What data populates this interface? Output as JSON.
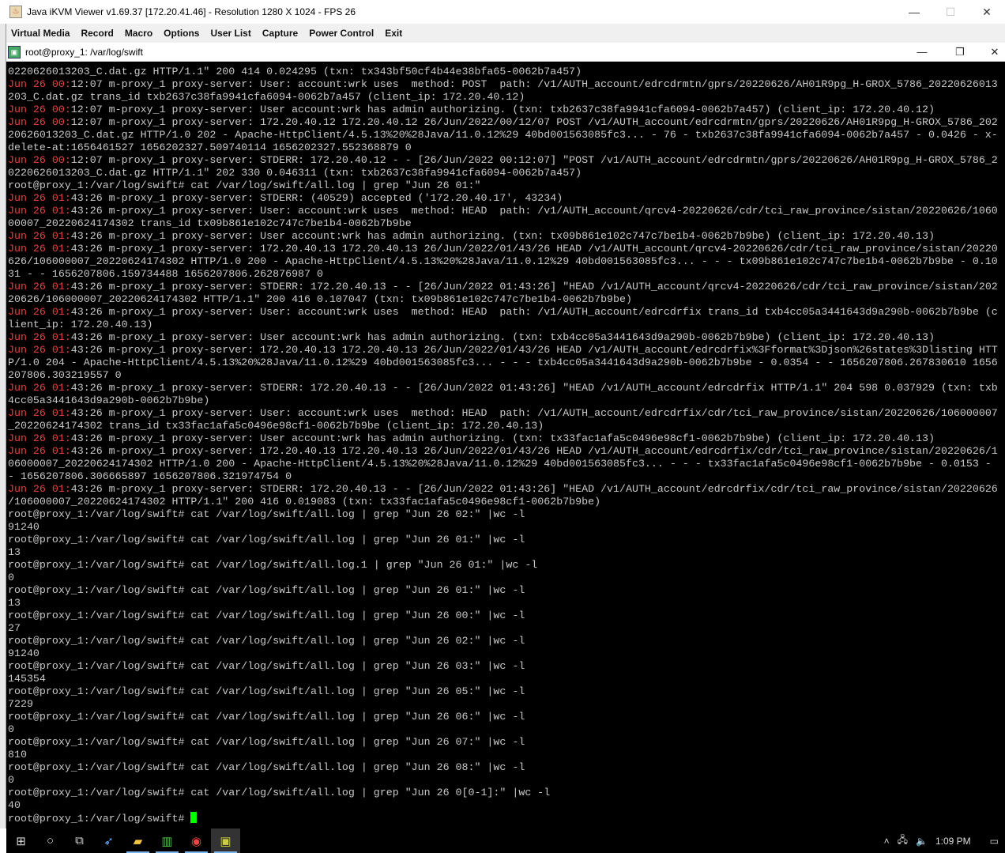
{
  "window": {
    "title": "Java iKVM Viewer v1.69.37 [172.20.41.46]  - Resolution 1280 X 1024 - FPS 26",
    "minimize": "—",
    "maximize": "☐",
    "close": "✕"
  },
  "menu": [
    "Virtual Media",
    "Record",
    "Macro",
    "Options",
    "User List",
    "Capture",
    "Power Control",
    "Exit"
  ],
  "terminal_window": {
    "title": "root@proxy_1: /var/log/swift",
    "minimize": "—",
    "restore": "❐",
    "close": "✕"
  },
  "terminal": {
    "lines": [
      {
        "p": "",
        "t": "0220626013203_C.dat.gz HTTP/1.1\" 200 414 0.024295 (txn: tx343bf50cf4b44e38bfa65-0062b7a457)"
      },
      {
        "p": "Jun 26 00:",
        "t": "12:07 m-proxy_1 proxy-server: User: account:wrk uses  method: POST  path: /v1/AUTH_account/edrcdrmtn/gprs/20220626/AH01R9pg_H-GROX_5786_20220626013"
      },
      {
        "p": "",
        "t": "203_C.dat.gz trans_id txb2637c38fa9941cfa6094-0062b7a457 (client_ip: 172.20.40.12)"
      },
      {
        "p": "Jun 26 00:",
        "t": "12:07 m-proxy_1 proxy-server: User account:wrk has admin authorizing. (txn: txb2637c38fa9941cfa6094-0062b7a457) (client_ip: 172.20.40.12)"
      },
      {
        "p": "Jun 26 00:",
        "t": "12:07 m-proxy_1 proxy-server: 172.20.40.12 172.20.40.12 26/Jun/2022/00/12/07 POST /v1/AUTH_account/edrcdrmtn/gprs/20220626/AH01R9pg_H-GROX_5786_202"
      },
      {
        "p": "",
        "t": "20626013203_C.dat.gz HTTP/1.0 202 - Apache-HttpClient/4.5.13%20%28Java/11.0.12%29 40bd001563085fc3... - 76 - txb2637c38fa9941cfa6094-0062b7a457 - 0.0426 - x-"
      },
      {
        "p": "",
        "t": "delete-at:1656461527 1656202327.509740114 1656202327.552368879 0"
      },
      {
        "p": "Jun 26 00:",
        "t": "12:07 m-proxy_1 proxy-server: STDERR: 172.20.40.12 - - [26/Jun/2022 00:12:07] \"POST /v1/AUTH_account/edrcdrmtn/gprs/20220626/AH01R9pg_H-GROX_5786_2"
      },
      {
        "p": "",
        "t": "0220626013203_C.dat.gz HTTP/1.1\" 202 330 0.046311 (txn: txb2637c38fa9941cfa6094-0062b7a457)"
      },
      {
        "p": "",
        "t": "root@proxy_1:/var/log/swift# cat /var/log/swift/all.log | grep \"Jun 26 01:\""
      },
      {
        "p": "Jun 26 01:",
        "t": "43:26 m-proxy_1 proxy-server: STDERR: (40529) accepted ('172.20.40.17', 43234)"
      },
      {
        "p": "Jun 26 01:",
        "t": "43:26 m-proxy_1 proxy-server: User: account:wrk uses  method: HEAD  path: /v1/AUTH_account/qrcv4-20220626/cdr/tci_raw_province/sistan/20220626/1060"
      },
      {
        "p": "",
        "t": "00007_20220624174302 trans_id tx09b861e102c747c7be1b4-0062b7b9be"
      },
      {
        "p": "Jun 26 01:",
        "t": "43:26 m-proxy_1 proxy-server: User account:wrk has admin authorizing. (txn: tx09b861e102c747c7be1b4-0062b7b9be) (client_ip: 172.20.40.13)"
      },
      {
        "p": "Jun 26 01:",
        "t": "43:26 m-proxy_1 proxy-server: 172.20.40.13 172.20.40.13 26/Jun/2022/01/43/26 HEAD /v1/AUTH_account/qrcv4-20220626/cdr/tci_raw_province/sistan/20220"
      },
      {
        "p": "",
        "t": "626/106000007_20220624174302 HTTP/1.0 200 - Apache-HttpClient/4.5.13%20%28Java/11.0.12%29 40bd001563085fc3... - - - tx09b861e102c747c7be1b4-0062b7b9be - 0.10"
      },
      {
        "p": "",
        "t": "31 - - 1656207806.159734488 1656207806.262876987 0"
      },
      {
        "p": "Jun 26 01:",
        "t": "43:26 m-proxy_1 proxy-server: STDERR: 172.20.40.13 - - [26/Jun/2022 01:43:26] \"HEAD /v1/AUTH_account/qrcv4-20220626/cdr/tci_raw_province/sistan/202"
      },
      {
        "p": "",
        "t": "20626/106000007_20220624174302 HTTP/1.1\" 200 416 0.107047 (txn: tx09b861e102c747c7be1b4-0062b7b9be)"
      },
      {
        "p": "Jun 26 01:",
        "t": "43:26 m-proxy_1 proxy-server: User: account:wrk uses  method: HEAD  path: /v1/AUTH_account/edrcdrfix trans_id txb4cc05a3441643d9a290b-0062b7b9be (c"
      },
      {
        "p": "",
        "t": "lient_ip: 172.20.40.13)"
      },
      {
        "p": "Jun 26 01:",
        "t": "43:26 m-proxy_1 proxy-server: User account:wrk has admin authorizing. (txn: txb4cc05a3441643d9a290b-0062b7b9be) (client_ip: 172.20.40.13)"
      },
      {
        "p": "Jun 26 01:",
        "t": "43:26 m-proxy_1 proxy-server: 172.20.40.13 172.20.40.13 26/Jun/2022/01/43/26 HEAD /v1/AUTH_account/edrcdrfix%3Fformat%3Djson%26states%3Dlisting HTT"
      },
      {
        "p": "",
        "t": "P/1.0 204 - Apache-HttpClient/4.5.13%20%28Java/11.0.12%29 40bd001563085fc3... - - - txb4cc05a3441643d9a290b-0062b7b9be - 0.0354 - - 1656207806.267830610 1656"
      },
      {
        "p": "",
        "t": "207806.303219557 0"
      },
      {
        "p": "Jun 26 01:",
        "t": "43:26 m-proxy_1 proxy-server: STDERR: 172.20.40.13 - - [26/Jun/2022 01:43:26] \"HEAD /v1/AUTH_account/edrcdrfix HTTP/1.1\" 204 598 0.037929 (txn: txb"
      },
      {
        "p": "",
        "t": "4cc05a3441643d9a290b-0062b7b9be)"
      },
      {
        "p": "Jun 26 01:",
        "t": "43:26 m-proxy_1 proxy-server: User: account:wrk uses  method: HEAD  path: /v1/AUTH_account/edrcdrfix/cdr/tci_raw_province/sistan/20220626/106000007"
      },
      {
        "p": "",
        "t": "_20220624174302 trans_id tx33fac1afa5c0496e98cf1-0062b7b9be (client_ip: 172.20.40.13)"
      },
      {
        "p": "Jun 26 01:",
        "t": "43:26 m-proxy_1 proxy-server: User account:wrk has admin authorizing. (txn: tx33fac1afa5c0496e98cf1-0062b7b9be) (client_ip: 172.20.40.13)"
      },
      {
        "p": "Jun 26 01:",
        "t": "43:26 m-proxy_1 proxy-server: 172.20.40.13 172.20.40.13 26/Jun/2022/01/43/26 HEAD /v1/AUTH_account/edrcdrfix/cdr/tci_raw_province/sistan/20220626/1"
      },
      {
        "p": "",
        "t": "06000007_20220624174302 HTTP/1.0 200 - Apache-HttpClient/4.5.13%20%28Java/11.0.12%29 40bd001563085fc3... - - - tx33fac1afa5c0496e98cf1-0062b7b9be - 0.0153 -"
      },
      {
        "p": "",
        "t": "- 1656207806.306665897 1656207806.321974754 0"
      },
      {
        "p": "Jun 26 01:",
        "t": "43:26 m-proxy_1 proxy-server: STDERR: 172.20.40.13 - - [26/Jun/2022 01:43:26] \"HEAD /v1/AUTH_account/edrcdrfix/cdr/tci_raw_province/sistan/20220626"
      },
      {
        "p": "",
        "t": "/106000007_20220624174302 HTTP/1.1\" 200 416 0.019083 (txn: tx33fac1afa5c0496e98cf1-0062b7b9be)"
      },
      {
        "p": "",
        "t": "root@proxy_1:/var/log/swift# cat /var/log/swift/all.log | grep \"Jun 26 02:\" |wc -l"
      },
      {
        "p": "",
        "t": "91240"
      },
      {
        "p": "",
        "t": "root@proxy_1:/var/log/swift# cat /var/log/swift/all.log | grep \"Jun 26 01:\" |wc -l"
      },
      {
        "p": "",
        "t": "13"
      },
      {
        "p": "",
        "t": "root@proxy_1:/var/log/swift# cat /var/log/swift/all.log.1 | grep \"Jun 26 01:\" |wc -l"
      },
      {
        "p": "",
        "t": "0"
      },
      {
        "p": "",
        "t": "root@proxy_1:/var/log/swift# cat /var/log/swift/all.log | grep \"Jun 26 01:\" |wc -l"
      },
      {
        "p": "",
        "t": "13"
      },
      {
        "p": "",
        "t": "root@proxy_1:/var/log/swift# cat /var/log/swift/all.log | grep \"Jun 26 00:\" |wc -l"
      },
      {
        "p": "",
        "t": "27"
      },
      {
        "p": "",
        "t": "root@proxy_1:/var/log/swift# cat /var/log/swift/all.log | grep \"Jun 26 02:\" |wc -l"
      },
      {
        "p": "",
        "t": "91240"
      },
      {
        "p": "",
        "t": "root@proxy_1:/var/log/swift# cat /var/log/swift/all.log | grep \"Jun 26 03:\" |wc -l"
      },
      {
        "p": "",
        "t": "145354"
      },
      {
        "p": "",
        "t": "root@proxy_1:/var/log/swift# cat /var/log/swift/all.log | grep \"Jun 26 05:\" |wc -l"
      },
      {
        "p": "",
        "t": "7229"
      },
      {
        "p": "",
        "t": "root@proxy_1:/var/log/swift# cat /var/log/swift/all.log | grep \"Jun 26 06:\" |wc -l"
      },
      {
        "p": "",
        "t": "0"
      },
      {
        "p": "",
        "t": "root@proxy_1:/var/log/swift# cat /var/log/swift/all.log | grep \"Jun 26 07:\" |wc -l"
      },
      {
        "p": "",
        "t": "810"
      },
      {
        "p": "",
        "t": "root@proxy_1:/var/log/swift# cat /var/log/swift/all.log | grep \"Jun 26 08:\" |wc -l"
      },
      {
        "p": "",
        "t": "0"
      },
      {
        "p": "",
        "t": "root@proxy_1:/var/log/swift# cat /var/log/swift/all.log | grep \"Jun 26 0[0-1]:\" |wc -l"
      },
      {
        "p": "",
        "t": "40"
      }
    ],
    "prompt": "root@proxy_1:/var/log/swift# "
  },
  "taskbar": {
    "clock": "1:09 PM"
  },
  "colors": {
    "log_prefix": "#e84040",
    "cursor": "#00ff00",
    "terminal_bg": "#000000"
  }
}
